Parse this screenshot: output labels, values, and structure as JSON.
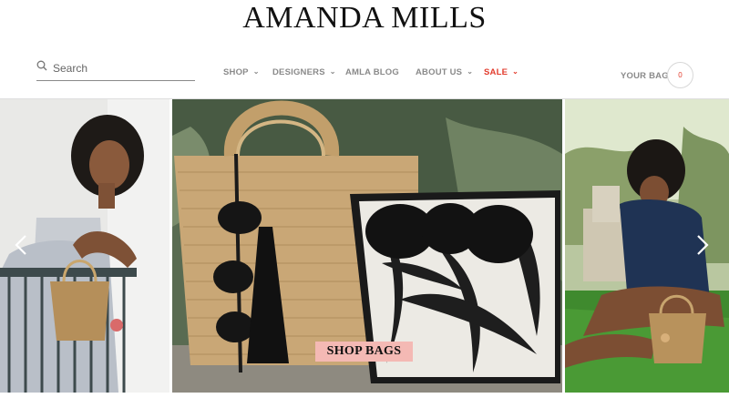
{
  "brand": {
    "logo_text": "AMANDA MILLS"
  },
  "search": {
    "placeholder": "Search",
    "value": ""
  },
  "nav": {
    "items": [
      {
        "label": "SHOP",
        "has_dropdown": true
      },
      {
        "label": "DESIGNERS",
        "has_dropdown": true
      },
      {
        "label": "AMLA BLOG",
        "has_dropdown": false
      },
      {
        "label": "ABOUT US",
        "has_dropdown": true
      },
      {
        "label": "SALE",
        "has_dropdown": true
      }
    ]
  },
  "bag": {
    "label": "YOUR BAG",
    "count": "0"
  },
  "hero": {
    "cta_label": "SHOP BAGS",
    "prev_icon": "chevron-left-icon",
    "next_icon": "chevron-right-icon"
  },
  "colors": {
    "accent": "#e23b2c",
    "nav_text": "#8a8a8a",
    "cta_background": "#f4b9b4"
  }
}
